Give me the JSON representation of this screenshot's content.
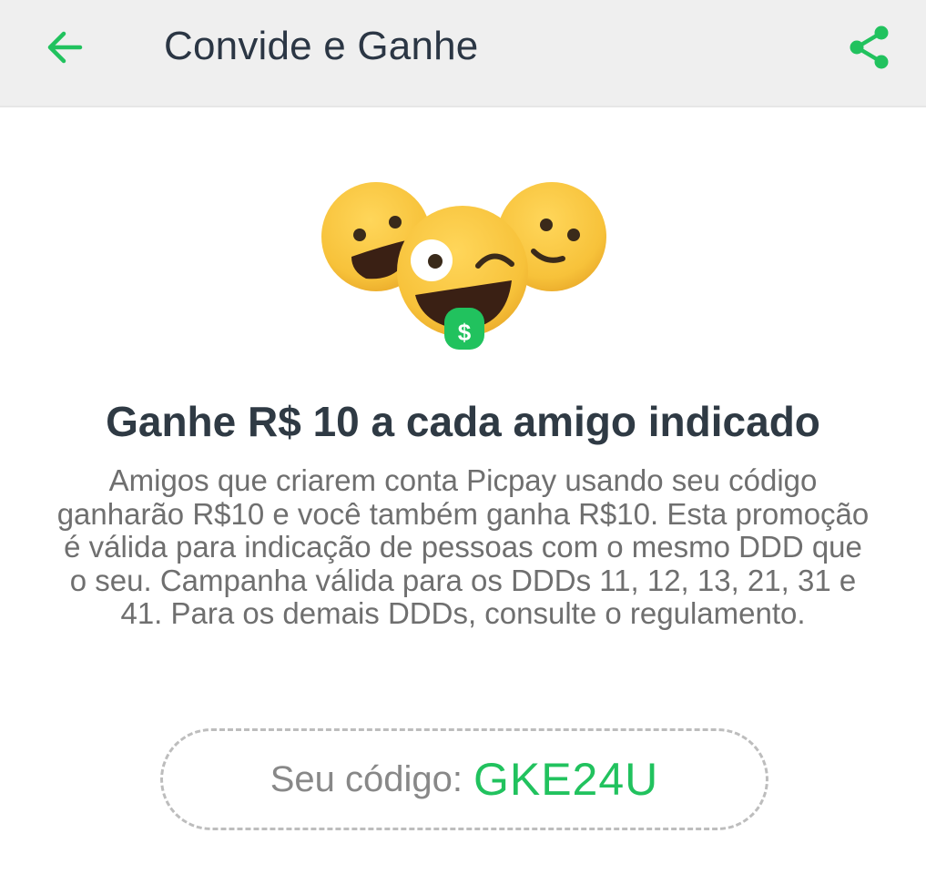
{
  "header": {
    "title": "Convide e Ganhe",
    "back_icon": "arrow-left-icon",
    "share_icon": "share-icon"
  },
  "illustration": {
    "icon": "friends-emoji-illustration",
    "tongue_symbol": "$"
  },
  "promo": {
    "headline": "Ganhe R$ 10 a cada amigo indicado",
    "description": "Amigos que criarem conta Picpay usando seu código ganharão R$10 e você também ganha R$10. Esta promoção é válida para indicação de pessoas com o mesmo DDD que o seu. Campanha válida para os DDDs 11, 12, 13, 21, 31 e 41. Para os demais DDDs, consulte o regulamento."
  },
  "referral": {
    "label": "Seu código:",
    "code": "GKE24U"
  },
  "colors": {
    "accent": "#21c25e",
    "title_text": "#2b3644",
    "body_text": "#6f6f6f",
    "appbar_bg": "#efefef",
    "emoji_yellow": "#f7c23a"
  }
}
